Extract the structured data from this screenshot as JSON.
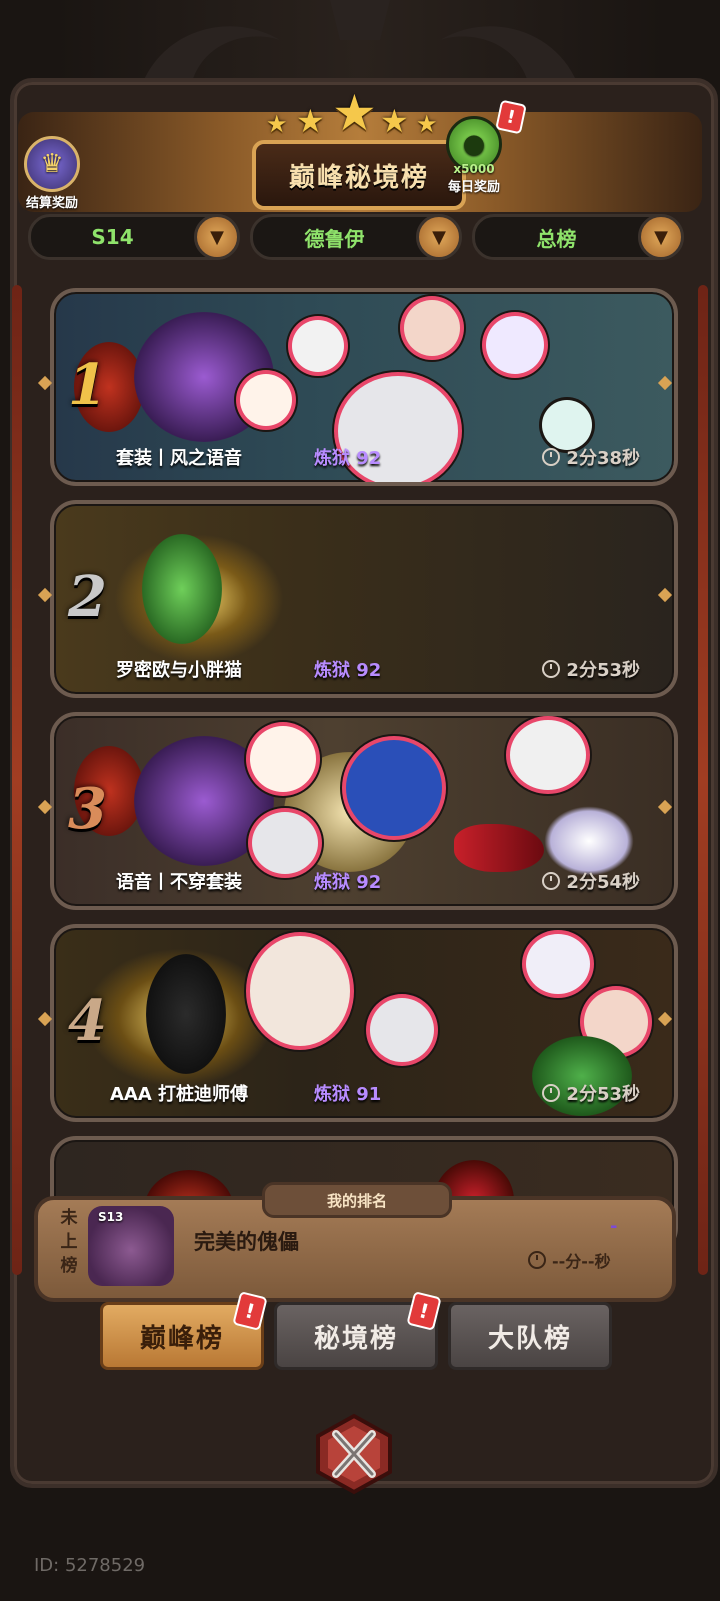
{
  "header": {
    "title": "巅峰秘境榜",
    "settlement_reward_label": "结算奖励",
    "daily_reward_label": "每日奖励",
    "daily_reward_count": "x5000",
    "alert_mark": "!"
  },
  "filters": [
    {
      "label": "S14"
    },
    {
      "label": "德鲁伊"
    },
    {
      "label": "总榜"
    }
  ],
  "rankings": [
    {
      "rank": "1",
      "name": "套装丨风之语音",
      "level": "炼狱 92",
      "time": "2分38秒",
      "rank_color": "#f0c24a"
    },
    {
      "rank": "2",
      "name": "罗密欧与小胖猫",
      "level": "炼狱 92",
      "time": "2分53秒",
      "rank_color": "#c9c9c9"
    },
    {
      "rank": "3",
      "name": "语音丨不穿套装",
      "level": "炼狱 92",
      "time": "2分54秒",
      "rank_color": "#d98c5a"
    },
    {
      "rank": "4",
      "name": "AAA 打桩迪师傅",
      "level": "炼狱 91",
      "time": "2分53秒",
      "rank_color": "#c9a888"
    }
  ],
  "my_rank": {
    "tab_label": "我的排名",
    "status": "未上榜",
    "season": "S13",
    "name": "完美的傀儡",
    "level": "-",
    "time": "--分--秒"
  },
  "tabs": [
    {
      "label": "巅峰榜",
      "active": true,
      "badge": "!"
    },
    {
      "label": "秘境榜",
      "active": false,
      "badge": "!"
    },
    {
      "label": "大队榜",
      "active": false
    }
  ],
  "footer": {
    "id_text": "ID: 5278529"
  },
  "colors": {
    "accent_gold": "#d9a354",
    "level_purple": "#b88cff",
    "filter_green": "#8fe36b",
    "alert_red": "#e23a3a"
  }
}
